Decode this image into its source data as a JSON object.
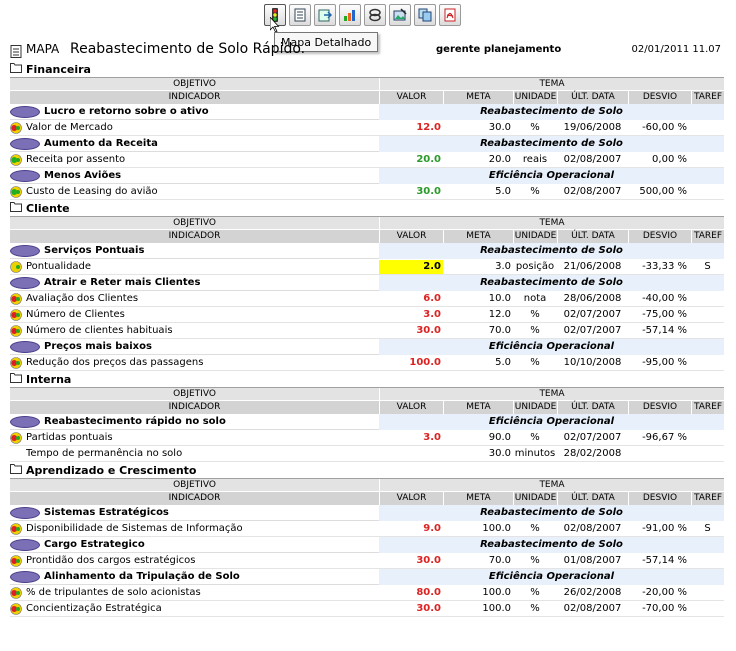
{
  "toolbar": {
    "buttons": [
      {
        "icon": "traffic-light-icon",
        "active": true
      },
      {
        "icon": "document-icon"
      },
      {
        "icon": "export-icon"
      },
      {
        "icon": "chart-icon"
      },
      {
        "icon": "link-icon"
      },
      {
        "icon": "image-edit-icon"
      },
      {
        "icon": "copy-icon"
      },
      {
        "icon": "pdf-icon"
      }
    ],
    "tooltip": "Mapa Detalhado"
  },
  "header": {
    "label": "MAPA",
    "title": "Reabastecimento de Solo Rápido.",
    "manager": "gerente planejamento",
    "datetime": "02/01/2011 11.07"
  },
  "columns": {
    "objetivo": "OBJETIVO",
    "tema": "TEMA",
    "indicador": "INDICADOR",
    "valor": "VALOR",
    "meta": "META",
    "unidade": "UNIDADE",
    "ult_data": "ÚLT. DATA",
    "desvio": "DESVIO",
    "tarefa": "TAREF"
  },
  "colors": {
    "red": "#d22222",
    "green": "#2a9a2a",
    "yellow": "#ffff00",
    "objective_oval": "#7b6fb6",
    "tema_bg": "#e8f1fb"
  },
  "perspectives": [
    {
      "name": "Financeira",
      "objectives": [
        {
          "name": "Lucro e retorno sobre o ativo",
          "tema": "Reabastecimento de Solo",
          "indicators": [
            {
              "name": "Valor de Mercado",
              "status": "red",
              "valor": "12.0",
              "meta": "30.0",
              "unidade": "%",
              "data": "19/06/2008",
              "desvio": "-60,00 %",
              "tarefa": ""
            }
          ]
        },
        {
          "name": "Aumento da Receita",
          "tema": "Reabastecimento de Solo",
          "indicators": [
            {
              "name": "Receita por assento",
              "status": "green",
              "valor": "20.0",
              "meta": "20.0",
              "unidade": "reais",
              "data": "02/08/2007",
              "desvio": "0,00 %",
              "tarefa": ""
            }
          ]
        },
        {
          "name": "Menos Aviões",
          "tema": "Eficiência Operacional",
          "indicators": [
            {
              "name": "Custo de Leasing do avião",
              "status": "green",
              "valor": "30.0",
              "meta": "5.0",
              "unidade": "%",
              "data": "02/08/2007",
              "desvio": "500,00 %",
              "tarefa": ""
            }
          ]
        }
      ]
    },
    {
      "name": "Cliente",
      "objectives": [
        {
          "name": "Serviços Pontuais",
          "tema": "Reabastecimento de Solo",
          "indicators": [
            {
              "name": "Pontualidade",
              "status": "yellow",
              "valor": "2.0",
              "meta": "3.0",
              "unidade": "posição",
              "data": "21/06/2008",
              "desvio": "-33,33 %",
              "tarefa": "S"
            }
          ]
        },
        {
          "name": "Atrair e Reter mais Clientes",
          "tema": "Reabastecimento de Solo",
          "indicators": [
            {
              "name": "Avaliação dos Clientes",
              "status": "red",
              "valor": "6.0",
              "meta": "10.0",
              "unidade": "nota",
              "data": "28/06/2008",
              "desvio": "-40,00 %",
              "tarefa": ""
            },
            {
              "name": "Número de Clientes",
              "status": "red",
              "valor": "3.0",
              "meta": "12.0",
              "unidade": "%",
              "data": "02/07/2007",
              "desvio": "-75,00 %",
              "tarefa": ""
            },
            {
              "name": "Número de clientes habituais",
              "status": "red",
              "valor": "30.0",
              "meta": "70.0",
              "unidade": "%",
              "data": "02/07/2007",
              "desvio": "-57,14 %",
              "tarefa": ""
            }
          ]
        },
        {
          "name": "Preços mais baixos",
          "tema": "Eficiência Operacional",
          "indicators": [
            {
              "name": "Redução dos preços das passagens",
              "status": "red",
              "valor": "100.0",
              "meta": "5.0",
              "unidade": "%",
              "data": "10/10/2008",
              "desvio": "-95,00 %",
              "tarefa": ""
            }
          ]
        }
      ]
    },
    {
      "name": "Interna",
      "objectives": [
        {
          "name": "Reabastecimento rápido no solo",
          "tema": "Eficiência Operacional",
          "indicators": [
            {
              "name": "Partidas pontuais",
              "status": "red",
              "valor": "3.0",
              "meta": "90.0",
              "unidade": "%",
              "data": "02/07/2007",
              "desvio": "-96,67 %",
              "tarefa": ""
            },
            {
              "name": "Tempo de permanência no solo",
              "status": "none",
              "valor": "",
              "meta": "30.0",
              "unidade": "minutos",
              "data": "28/02/2008",
              "desvio": "",
              "tarefa": ""
            }
          ]
        }
      ]
    },
    {
      "name": "Aprendizado e Crescimento",
      "objectives": [
        {
          "name": "Sistemas Estratégicos",
          "tema": "Reabastecimento de Solo",
          "indicators": [
            {
              "name": "Disponibilidade de Sistemas de Informação",
              "status": "red",
              "valor": "9.0",
              "meta": "100.0",
              "unidade": "%",
              "data": "02/08/2007",
              "desvio": "-91,00 %",
              "tarefa": "S"
            }
          ]
        },
        {
          "name": "Cargo Estrategico",
          "tema": "Reabastecimento de Solo",
          "indicators": [
            {
              "name": "Prontidão dos cargos estratégicos",
              "status": "red",
              "valor": "30.0",
              "meta": "70.0",
              "unidade": "%",
              "data": "01/08/2007",
              "desvio": "-57,14 %",
              "tarefa": ""
            }
          ]
        },
        {
          "name": "Alinhamento da Tripulação de Solo",
          "tema": "Eficiência Operacional",
          "indicators": [
            {
              "name": "% de tripulantes de solo acionistas",
              "status": "red",
              "valor": "80.0",
              "meta": "100.0",
              "unidade": "%",
              "data": "26/02/2008",
              "desvio": "-20,00 %",
              "tarefa": ""
            },
            {
              "name": "Concientização Estratégica",
              "status": "red",
              "valor": "30.0",
              "meta": "100.0",
              "unidade": "%",
              "data": "02/08/2007",
              "desvio": "-70,00 %",
              "tarefa": ""
            }
          ]
        }
      ]
    }
  ]
}
